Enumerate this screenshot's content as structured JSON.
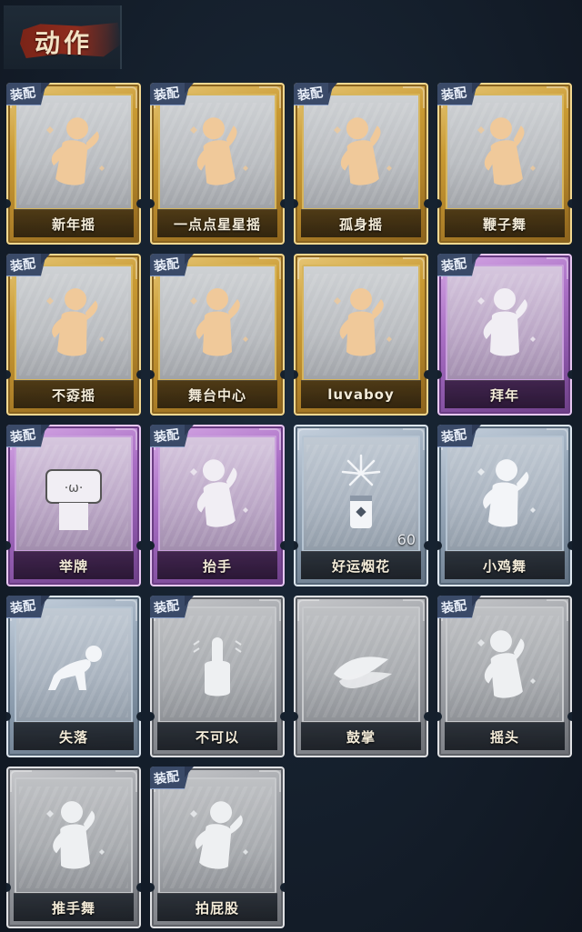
{
  "header": {
    "title": "动作"
  },
  "badge_label": "装配",
  "cards": [
    {
      "name": "新年摇",
      "rarity": "gold",
      "equipped": true,
      "icon": "new-year-shake-pose-icon"
    },
    {
      "name": "一点点星星摇",
      "rarity": "gold",
      "equipped": true,
      "icon": "star-shake-pose-icon"
    },
    {
      "name": "孤身摇",
      "rarity": "gold",
      "equipped": true,
      "icon": "solo-shake-pose-icon"
    },
    {
      "name": "鞭子舞",
      "rarity": "gold",
      "equipped": true,
      "icon": "whip-dance-pose-icon"
    },
    {
      "name": "不孬摇",
      "rarity": "gold",
      "equipped": true,
      "icon": "not-bad-shake-pose-icon"
    },
    {
      "name": "舞台中心",
      "rarity": "gold",
      "equipped": true,
      "icon": "center-stage-pose-icon"
    },
    {
      "name": "luvaboy",
      "rarity": "gold",
      "equipped": false,
      "icon": "luvaboy-pose-icon"
    },
    {
      "name": "拜年",
      "rarity": "purple",
      "equipped": true,
      "icon": "new-year-greeting-pose-icon"
    },
    {
      "name": "举牌",
      "rarity": "purple",
      "equipped": true,
      "icon": "hold-sign-pose-icon"
    },
    {
      "name": "抬手",
      "rarity": "purple",
      "equipped": true,
      "icon": "raise-hand-pose-icon"
    },
    {
      "name": "好运烟花",
      "rarity": "blue",
      "equipped": false,
      "icon": "firework-icon",
      "count": "60"
    },
    {
      "name": "小鸡舞",
      "rarity": "blue",
      "equipped": true,
      "icon": "chicken-dance-pose-icon"
    },
    {
      "name": "失落",
      "rarity": "blue",
      "equipped": true,
      "icon": "lost-crawl-pose-icon"
    },
    {
      "name": "不可以",
      "rarity": "gray",
      "equipped": true,
      "icon": "wagging-finger-icon"
    },
    {
      "name": "鼓掌",
      "rarity": "gray",
      "equipped": false,
      "icon": "clapping-hands-icon"
    },
    {
      "name": "摇头",
      "rarity": "gray",
      "equipped": true,
      "icon": "head-shake-pose-icon"
    },
    {
      "name": "推手舞",
      "rarity": "gray",
      "equipped": false,
      "icon": "push-hands-dance-pose-icon"
    },
    {
      "name": "拍屁股",
      "rarity": "gray",
      "equipped": true,
      "icon": "butt-slap-pose-icon"
    }
  ]
}
